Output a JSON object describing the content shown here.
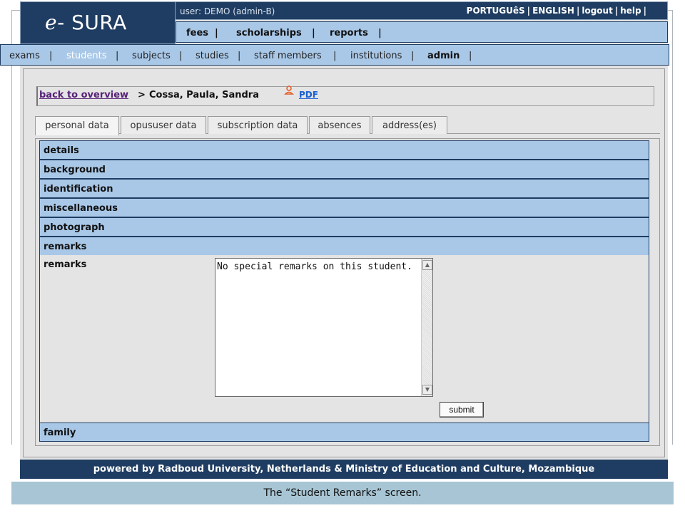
{
  "header": {
    "logo": "e- SURA",
    "user_label": "user: DEMO (admin-B)",
    "lang_links": [
      "PORTUGUêS",
      "ENGLISH",
      "logout",
      "help"
    ]
  },
  "top_menu": {
    "fees": "fees",
    "scholarships": "scholarships",
    "reports": "reports"
  },
  "main_menu": {
    "exams": "exams",
    "students": "students",
    "subjects": "subjects",
    "studies": "studies",
    "staff_members": "staff members",
    "institutions": "institutions",
    "admin": "admin",
    "active": "students"
  },
  "breadcrumb": {
    "back_label": "back to overview",
    "separator": ">",
    "student_name": "Cossa, Paula, Sandra",
    "pdf_label": "PDF"
  },
  "tabs": [
    {
      "label": "personal data",
      "active": true
    },
    {
      "label": "opususer data",
      "active": false
    },
    {
      "label": "subscription data",
      "active": false
    },
    {
      "label": "absences",
      "active": false
    },
    {
      "label": "address(es)",
      "active": false
    }
  ],
  "sections": {
    "details": "details",
    "background": "background",
    "identification": "identification",
    "miscellaneous": "miscellaneous",
    "photograph": "photograph",
    "remarks": "remarks",
    "family": "family"
  },
  "remarks_form": {
    "field_label": "remarks",
    "value": "No special remarks on this student. ",
    "submit_label": "submit"
  },
  "footer": {
    "text": "powered by Radboud University, Netherlands & Ministry of Education and Culture, Mozambique"
  },
  "caption": "The “Student Remarks” screen.",
  "colors": {
    "header_navy": "#1f3d62",
    "menu_blue": "#a9c8e8",
    "background_gray": "#e4e4e4",
    "caption_bar": "#a7c5d4",
    "visited_link": "#552277",
    "link_blue": "#1a5fd0"
  }
}
